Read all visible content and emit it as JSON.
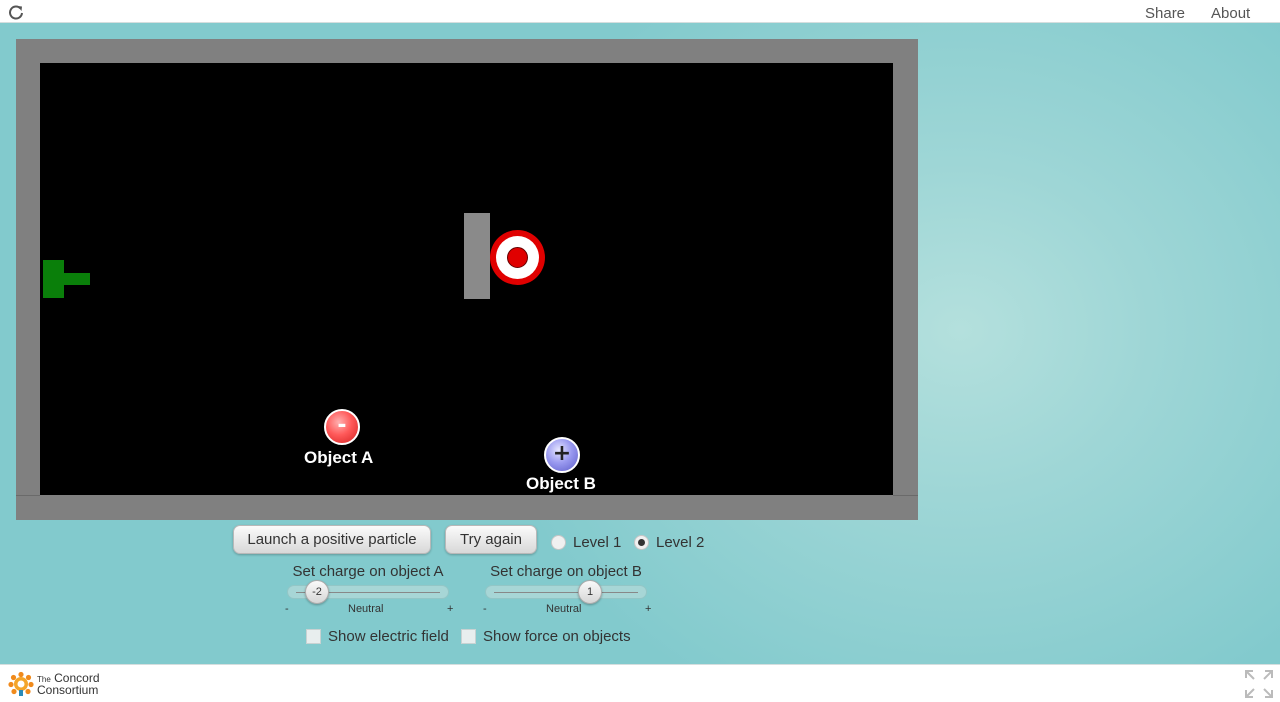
{
  "topbar": {
    "share_label": "Share",
    "about_label": "About"
  },
  "simulation": {
    "object_a": {
      "symbol": "-",
      "label": "Object A"
    },
    "object_b": {
      "symbol": "+",
      "label": "Object B"
    }
  },
  "controls": {
    "launch_label": "Launch a positive particle",
    "try_again_label": "Try again",
    "levels": [
      {
        "label": "Level 1",
        "selected": false
      },
      {
        "label": "Level 2",
        "selected": true
      }
    ],
    "slider_a": {
      "title": "Set charge on object A",
      "value": "-2",
      "min_label": "-",
      "mid_label": "Neutral",
      "max_label": "+"
    },
    "slider_b": {
      "title": "Set charge on object B",
      "value": "1",
      "min_label": "-",
      "mid_label": "Neutral",
      "max_label": "+"
    },
    "show_field_label": "Show electric field",
    "show_force_label": "Show force on objects"
  },
  "footer": {
    "logo_line1_small": "The",
    "logo_line1": "Concord",
    "logo_line2": "Consortium"
  },
  "colors": {
    "launcher": "#0a7f0a",
    "target_red": "#e00000",
    "negative_charge": "#ff5a5a",
    "positive_charge": "#9a9af0",
    "canvas": "#000000",
    "frame": "#808080"
  },
  "icons": [
    "reload-icon",
    "fullscreen-icon",
    "concord-logo-icon"
  ]
}
